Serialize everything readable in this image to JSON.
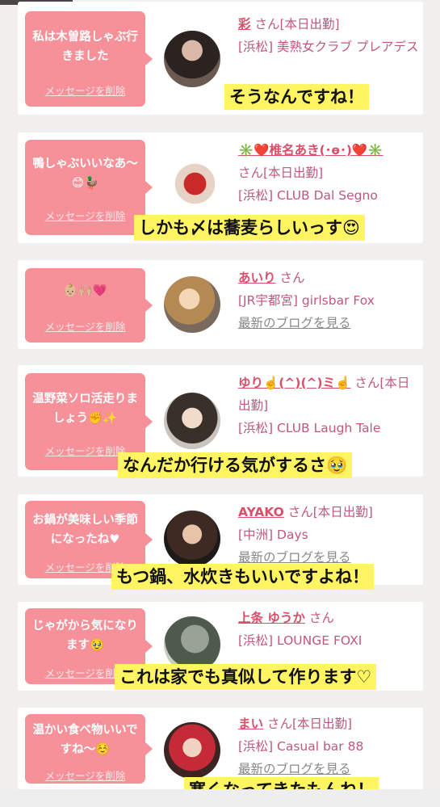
{
  "entries": [
    {
      "message": "私は木曽路しゃぶ行きました",
      "delete_label": "メッセージを削除",
      "name": "彩",
      "san": "さん[本日出勤]",
      "shop": "[浜松] 美熟女クラブ プレアデス",
      "blog": "",
      "caption": "そうなんですね！"
    },
    {
      "message": "鴨しゃぶいいなあ〜😊🦆",
      "delete_label": "メッセージを削除",
      "name": "✳️❤️椎名あき(･ө･)❤️✳️",
      "san": "さん[本日出勤]",
      "shop": "[浜松] CLUB Dal Segno",
      "blog": "",
      "caption": "しかも〆は蕎麦らしいっす😍"
    },
    {
      "message": "👶🏼🙌🏼💗",
      "delete_label": "メッセージを削除",
      "name": "あいり",
      "san": "さん",
      "shop": "[JR宇都宮] girlsbar Fox",
      "blog": "最新のブログを見る",
      "caption": ""
    },
    {
      "message": "温野菜ソロ活走りましょう✊✨",
      "delete_label": "メッセージを削除",
      "name": "ゆり☝️(^)(^)ミ☝️",
      "san": "さん[本日出勤]",
      "shop": "[浜松] CLUB Laugh Tale",
      "blog": "",
      "caption": "なんだか行ける気がするさ🥹"
    },
    {
      "message": "お鍋が美味しい季節になったね♥",
      "delete_label": "メッセージを削除",
      "name": "AYAKO",
      "san": "さん[本日出勤]",
      "shop": "[中洲] Days",
      "blog": "最新のブログを見る",
      "caption": "もつ鍋、水炊きもいいですよね！"
    },
    {
      "message": "じゃがから気になります🥹",
      "delete_label": "メッセージを削除",
      "name": "上条 ゆうか",
      "san": "さん",
      "shop": "[浜松] LOUNGE FOXI",
      "blog": "",
      "caption": "これは家でも真似して作ります♡"
    },
    {
      "message": "温かい食べ物いいですね〜☺️",
      "delete_label": "メッセージを削除",
      "name": "まい",
      "san": "さん[本日出勤]",
      "shop": "[浜松] Casual bar 88",
      "blog": "最新のブログを見る",
      "caption": "寒くなってきたもんね！"
    }
  ]
}
